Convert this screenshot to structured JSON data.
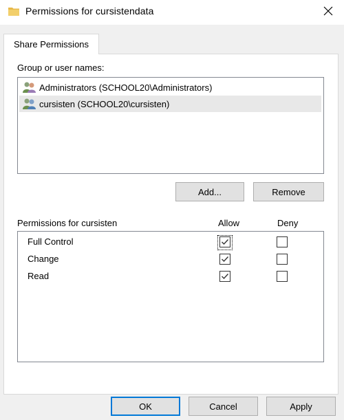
{
  "window": {
    "title": "Permissions for cursistendata",
    "folder_icon_color": "#e8b94a"
  },
  "tab": {
    "label": "Share Permissions"
  },
  "users_section": {
    "label": "Group or user names:",
    "items": [
      {
        "name": "Administrators (SCHOOL20\\Administrators)",
        "selected": false
      },
      {
        "name": "cursisten (SCHOOL20\\cursisten)",
        "selected": true
      }
    ]
  },
  "buttons": {
    "add": "Add...",
    "remove": "Remove",
    "ok": "OK",
    "cancel": "Cancel",
    "apply": "Apply"
  },
  "permissions": {
    "label": "Permissions for cursisten",
    "allow_header": "Allow",
    "deny_header": "Deny",
    "rows": [
      {
        "name": "Full Control",
        "allow": true,
        "deny": false
      },
      {
        "name": "Change",
        "allow": true,
        "deny": false
      },
      {
        "name": "Read",
        "allow": true,
        "deny": false
      }
    ]
  },
  "colors": {
    "accent": "#0078d7",
    "selection": "#e8e8e8"
  }
}
